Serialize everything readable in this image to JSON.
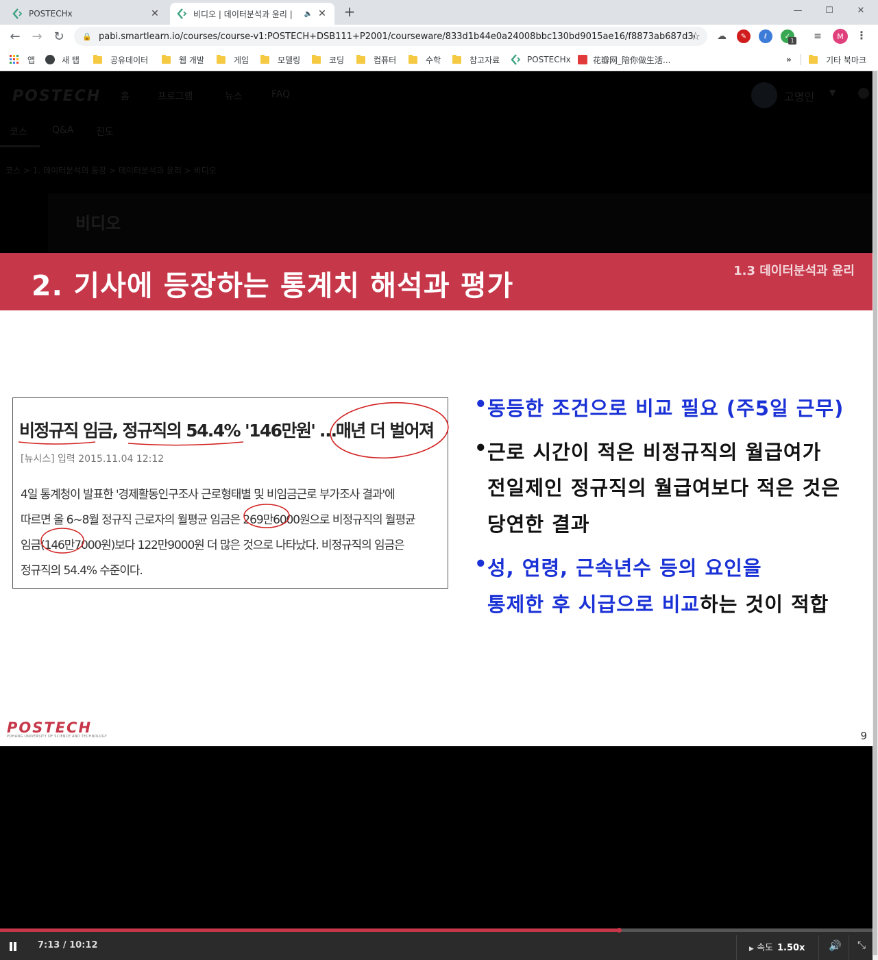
{
  "browser": {
    "tabs": [
      {
        "title": "POSTECHx",
        "close": "✕",
        "active": false
      },
      {
        "title": "비디오 | 데이터분석과 윤리 |",
        "close": "✕",
        "active": true,
        "audio": "🔈"
      }
    ],
    "new_tab": "+",
    "window_controls": {
      "minimize": "—",
      "maximize": "☐",
      "close": "✕"
    },
    "nav": {
      "back": "←",
      "forward": "→",
      "reload": "↻"
    },
    "url": "pabi.smartlearn.io/courses/course-v1:POSTECH+DSB111+P2001/courseware/833d1b44e0a24008bbc130bd9015ae16/f8873ab687d344f...",
    "star": "☆",
    "profile_initial": "M",
    "ext_badge": "1",
    "bookmarks": [
      {
        "label": "앱",
        "icon": "apps-icon"
      },
      {
        "label": "새 탭",
        "icon": "globe-icon"
      },
      {
        "label": "공유데이터",
        "icon": "folder-icon"
      },
      {
        "label": "웹 개발",
        "icon": "folder-icon"
      },
      {
        "label": "게임",
        "icon": "folder-icon"
      },
      {
        "label": "모델링",
        "icon": "folder-icon"
      },
      {
        "label": "코딩",
        "icon": "folder-icon"
      },
      {
        "label": "컴퓨터",
        "icon": "folder-icon"
      },
      {
        "label": "수학",
        "icon": "folder-icon"
      },
      {
        "label": "참고자료",
        "icon": "folder-icon"
      },
      {
        "label": "POSTECHx",
        "icon": "postechx-icon"
      },
      {
        "label": "花瓣网_陪你做生活...",
        "icon": "huaban-icon"
      }
    ],
    "bookmarks_more": "»",
    "other_bookmarks": "기타 북마크"
  },
  "site": {
    "logo": "POSTECH",
    "nav": [
      "홈",
      "프로그램",
      "뉴스",
      "FAQ"
    ],
    "user": "고명인",
    "course_tabs": [
      "코스",
      "Q&A",
      "진도"
    ],
    "breadcrumb": "코스 > 1. 데이터분석의 등장 > 데이터분석과 윤리 > 비디오",
    "unit_title": "비디오"
  },
  "slide": {
    "title": "2. 기사에 등장하는 통계치 해석과 평가",
    "section": "1.3 데이터분석과 윤리",
    "article": {
      "headline": "비정규직 임금, 정규직의 54.4% '146만원' …매년 더 벌어져",
      "dateline": "[뉴시스] 입력 2015.11.04 12:12",
      "body": [
        "4일 통계청이 발표한 '경제활동인구조사 근로형태별 및 비임금근로 부가조사 결과'에",
        "따르면 올 6~8월 정규직 근로자의 월평균 임금은 269만6000원으로 비정규직의 월평균",
        "임금(146만7000원)보다 122만9000원 더 많은 것으로 나타났다. 비정규직의 임금은",
        "정규직의 54.4% 수준이다."
      ]
    },
    "bullets": [
      {
        "dot": "•",
        "blue": "동등한 조건으로 비교 필요 (주5일 근무)",
        "black": ""
      },
      {
        "dot": "•",
        "blue": "",
        "black": "근로 시간이 적은 비정규직의 월급여가"
      },
      {
        "dot": "",
        "blue": "",
        "black": "전일제인 정규직의 월급여보다 적은 것은"
      },
      {
        "dot": "",
        "blue": "",
        "black": "당연한 결과"
      },
      {
        "dot": "•",
        "blue": "성, 연령, 근속년수 등의 요인을",
        "black": ""
      },
      {
        "dot": "",
        "blue": "통제한 후 시급으로 비교",
        "black": "하는 것이 적합"
      }
    ],
    "logo": "POSTECH",
    "logo_sub": "POHANG UNIVERSITY OF SCIENCE AND TECHNOLOGY",
    "page_number": "9",
    "colors": {
      "banner": "#c7374a",
      "highlight": "#1a31d6",
      "annotation": "#d11f1f"
    }
  },
  "player": {
    "time": "7:13 / 10:12",
    "progress": 0.709,
    "speed_label": "속도",
    "speed_value": "1.50x",
    "volume_icon": "🔊",
    "fullscreen_icon": "⤡"
  }
}
